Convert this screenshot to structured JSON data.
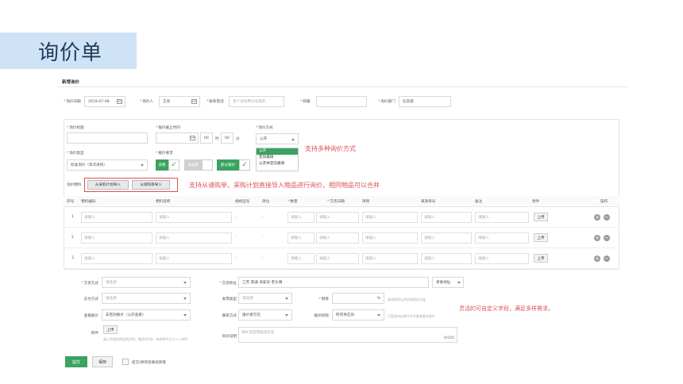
{
  "slide": {
    "title": "询价单"
  },
  "panel": {
    "title": "新增询价"
  },
  "top_row": {
    "date_label": "询价日期",
    "date_value": "2019-07-08",
    "inquirer_label": "询价人",
    "inquirer_value": "王亮",
    "phone_label": "联系电话",
    "phone_placeholder": "多个号码用分号隔开",
    "email_label": "邮箱",
    "email_value": "",
    "dept_label": "询价部门",
    "dept_value": "信息部"
  },
  "form": {
    "title_label": "询价标题",
    "deadline_label": "报价截止时间",
    "hour_value": "00",
    "hour_unit": "时",
    "minute_value": "00",
    "minute_unit": "分",
    "method_label": "询价方式",
    "method_value": "公开",
    "method_options": [
      "公开",
      "定向邀请",
      "公开并定向邀请"
    ],
    "type_label": "询价类型",
    "type_value": "标准询价（单次采购）",
    "req_label": "报价要求",
    "tax_label": "含税",
    "notax_label": "含运费",
    "partial_label": "部分报价"
  },
  "import": {
    "label": "询价物料",
    "from_plan_button": "从采购计划导入",
    "from_requisition_button": "从请购单导入"
  },
  "annotations": {
    "method_note": "支持多种询价方式",
    "import_note": "支持从请购单、采购计划直接导入物品进行询价，相同物品可以合并",
    "custom_note": "灵活的可自定义字段，满足多样需求。"
  },
  "table": {
    "headers": [
      "序号",
      "物料编码",
      "物料名称",
      "规格型号",
      "单位",
      "数量",
      "交货日期",
      "项目",
      "来源单号",
      "备注",
      "附件",
      "操作"
    ],
    "placeholder": "请输入",
    "dash": "-",
    "upload_label": "上传",
    "rows": [
      {
        "index": "1"
      },
      {
        "index": "2"
      },
      {
        "index": "3"
      }
    ]
  },
  "bottom": {
    "delivery_label": "交货方式",
    "delivery_value": "请选择",
    "address_label": "交货地址",
    "address_value": "江苏 南通 海安县 老头镇",
    "change_address": "更换地址",
    "payment_label": "支付方式",
    "payment_value": "请选择",
    "invoice_label": "发票类型",
    "invoice_value": "请选择",
    "tax_rate_label": "税率",
    "tax_rate_unit": "%",
    "tax_rate_hint": "具体税率以供应商报价为准",
    "quote_label": "查看报价",
    "quote_value": "非密封报价（公开查看）",
    "contact_label": "联系方式",
    "contact_value": "报价者可见",
    "scope_label": "报价权限",
    "scope_value": "所有供应商",
    "scope_hint": "已登录供应商平台才能查看并报价",
    "attach_label": "附件",
    "attach_button": "上传",
    "attach_hint": "请上传相关的说明文档，最多传5份，每份附件大小<=10M",
    "desc_label": "询价说明",
    "desc_placeholder": "请补充说明描述信息",
    "desc_count": "0/500"
  },
  "footer": {
    "submit": "提交",
    "save": "保存",
    "continue_label": "提交/保存后继续新增"
  }
}
